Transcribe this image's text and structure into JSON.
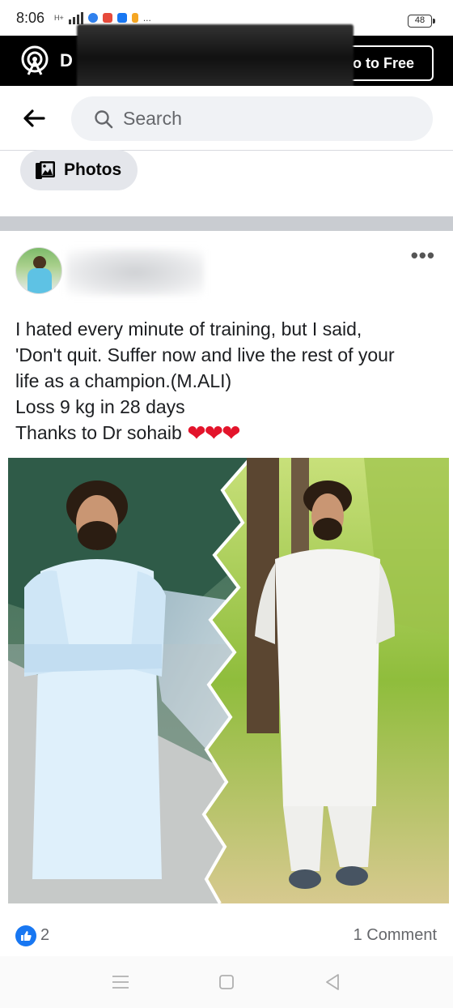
{
  "status_bar": {
    "time": "8:06",
    "network": "H+",
    "extra": "...",
    "battery": "48"
  },
  "promo": {
    "logo_icon": "podcast-antenna-icon",
    "text": "D",
    "button_label": "o to Free"
  },
  "search": {
    "back_icon": "arrow-left-icon",
    "search_icon": "search-icon",
    "placeholder": "Search"
  },
  "filter_chip": {
    "icon": "photos-icon",
    "label": "Photos"
  },
  "post": {
    "more_icon": "more-horizontal-icon",
    "text_lines": [
      "I hated every minute of training, but I said,",
      "'Don't quit. Suffer now and live the rest of your",
      "life as a champion.(M.ALI)",
      "Loss 9 kg in 28 days",
      "Thanks to Dr sohaib"
    ],
    "hearts": "❤❤❤",
    "like_count": "2",
    "comment_count": "1 Comment"
  },
  "colors": {
    "facebook_blue": "#1877f2",
    "heart_red": "#e3142b",
    "banner_black": "#000000",
    "chip_gray": "#e4e6eb"
  },
  "nav": {
    "menu_icon": "recents-icon",
    "home_icon": "home-square-icon",
    "back_icon": "back-triangle-icon"
  }
}
